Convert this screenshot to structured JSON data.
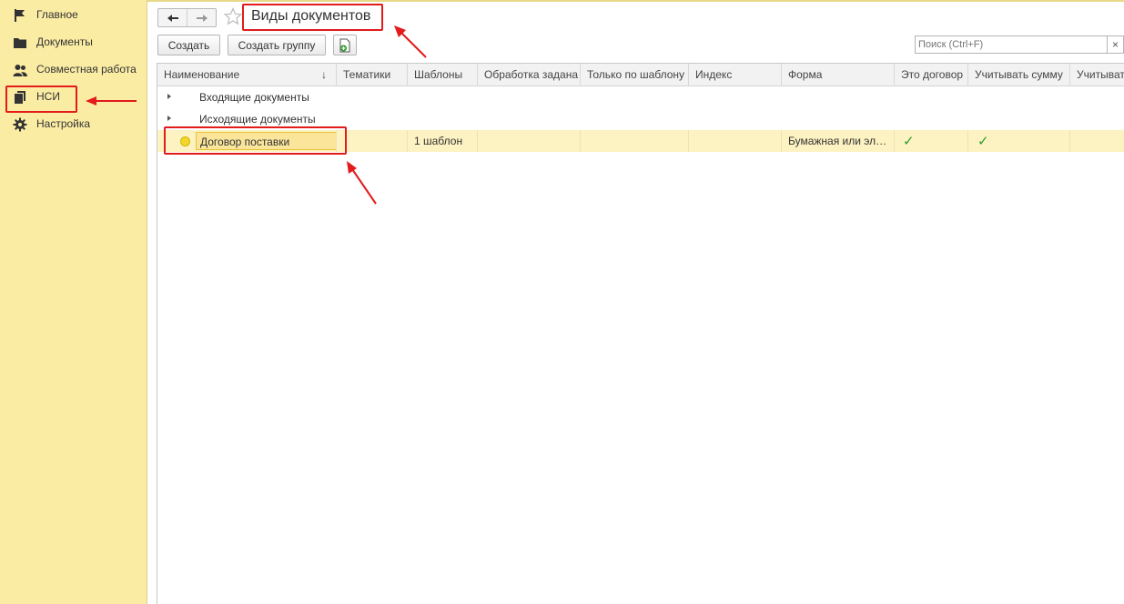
{
  "sidebar": {
    "items": [
      {
        "label": "Главное",
        "icon": "flag-icon"
      },
      {
        "label": "Документы",
        "icon": "folder-icon"
      },
      {
        "label": "Совместная работа",
        "icon": "users-icon"
      },
      {
        "label": "НСИ",
        "icon": "books-icon"
      },
      {
        "label": "Настройка",
        "icon": "gear-icon"
      }
    ]
  },
  "header": {
    "title": "Виды документов"
  },
  "toolbar": {
    "create_label": "Создать",
    "create_group_label": "Создать группу",
    "search_placeholder": "Поиск (Ctrl+F)",
    "clear_label": "×"
  },
  "table": {
    "columns": [
      "Наименование",
      "Тематики",
      "Шаблоны",
      "Обработка задана",
      "Только по шаблону",
      "Индекс",
      "Форма",
      "Это договор",
      "Учитывать сумму",
      "Учитыват"
    ],
    "sort_indicator": "↓",
    "rows": [
      {
        "name": "Входящие документы",
        "type": "group"
      },
      {
        "name": "Исходящие документы",
        "type": "group"
      },
      {
        "name": "Договор поставки",
        "type": "item",
        "templates": "1 шаблон",
        "form": "Бумажная или эл…",
        "is_contract": "✓",
        "count_sum": "✓"
      }
    ]
  },
  "colors": {
    "sidebar_bg": "#fbeca4",
    "selected_row": "#fdf2c1",
    "annotation_red": "#e21b1b",
    "check_green": "#2c9c2c"
  }
}
